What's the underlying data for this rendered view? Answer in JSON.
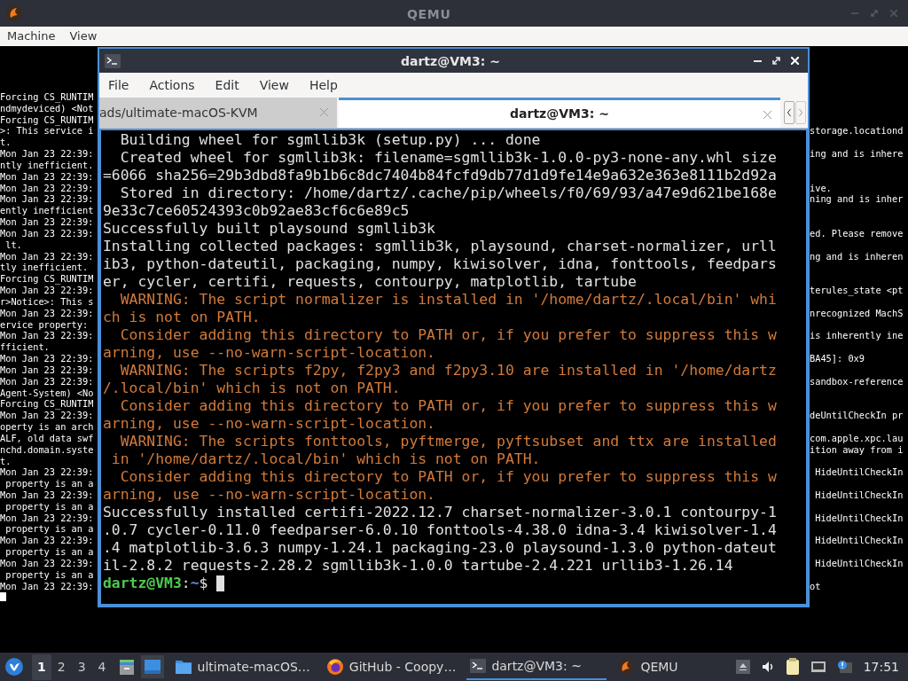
{
  "qemu_window": {
    "title": "QEMU",
    "menu": [
      "Machine",
      "View"
    ]
  },
  "console": {
    "lines": [
      {
        "left": "Forcing CS_RUNTIM"
      },
      {
        "left": "ndmydeviced) <Not"
      },
      {
        "left": "Forcing CS_RUNTIM"
      },
      {
        "left": ">: This service i",
        "right": "storage.locationd"
      },
      {
        "left": "t."
      },
      {
        "left": "Mon Jan 23 22:39:",
        "right": "ing and is inhere"
      },
      {
        "left": "ntly inefficient."
      },
      {
        "left": "Mon Jan 23 22:39:"
      },
      {
        "left": "Mon Jan 23 22:39:",
        "right": "ive."
      },
      {
        "left": "Mon Jan 23 22:39:",
        "right": "ning and is inher"
      },
      {
        "left": "ently inefficient"
      },
      {
        "left": "Mon Jan 23 22:39:"
      },
      {
        "left": "Mon Jan 23 22:39:",
        "right": "ed. Please remove"
      },
      {
        "left": " lt."
      },
      {
        "left": "Mon Jan 23 22:39:",
        "right": "ng and is inheren"
      },
      {
        "left": "tly inefficient."
      },
      {
        "left": "Forcing CS_RUNTIM"
      },
      {
        "left": "Mon Jan 23 22:39:",
        "right": "terules_state <pt"
      },
      {
        "left": "r>Notice>: This s"
      },
      {
        "left": "Mon Jan 23 22:39:",
        "right": "nrecognized MachS"
      },
      {
        "left": "ervice property:"
      },
      {
        "left": "Mon Jan 23 22:39:",
        "right": "is inherently ine"
      },
      {
        "left": "fficient."
      },
      {
        "left": "Mon Jan 23 22:39:",
        "right": "BA45]: 0x9"
      },
      {
        "left": "Mon Jan 23 22:39:"
      },
      {
        "left": "Mon Jan 23 22:39:",
        "right": "sandbox-reference"
      },
      {
        "left": "Agent-System) <No"
      },
      {
        "left": "Forcing CS_RUNTIM"
      },
      {
        "left": "Mon Jan 23 22:39:",
        "right": "deUntilCheckIn pr"
      },
      {
        "left": "operty is an arch"
      },
      {
        "left": "ALF, old data swf",
        "right": "com.apple.xpc.lau"
      },
      {
        "left": "nchd.domain.syste",
        "right": "ition away from i"
      },
      {
        "left": "t."
      },
      {
        "left": "Mon Jan 23 22:39:",
        "right": " HideUntilCheckIn"
      },
      {
        "left": " property is an a"
      },
      {
        "left": "Mon Jan 23 22:39:",
        "right": " HideUntilCheckIn"
      },
      {
        "left": " property is an a"
      },
      {
        "left": "Mon Jan 23 22:39:",
        "right": " HideUntilCheckIn"
      },
      {
        "left": " property is an a"
      },
      {
        "left": "Mon Jan 23 22:39:",
        "right": " HideUntilCheckIn"
      },
      {
        "left": " property is an a"
      },
      {
        "left": "Mon Jan 23 22:39:",
        "right": " HideUntilCheckIn"
      },
      {
        "left": " property is an a"
      },
      {
        "left": "Mon Jan 23 22:39:",
        "right": "ot"
      }
    ]
  },
  "terminal_window": {
    "title": "dartz@VM3: ~",
    "menu": [
      "File",
      "Actions",
      "Edit",
      "View",
      "Help"
    ],
    "tabs": [
      {
        "label": "ads/ultimate-macOS-KVM",
        "selected": false
      },
      {
        "label": "dartz@VM3: ~",
        "selected": true
      }
    ],
    "lines": [
      {
        "kind": "output",
        "text": "  Building wheel for sgmllib3k (setup.py) ... done"
      },
      {
        "kind": "output",
        "text": "  Created wheel for sgmllib3k: filename=sgmllib3k-1.0.0-py3-none-any.whl size"
      },
      {
        "kind": "output",
        "text": "=6066 sha256=29b3dbd8fa9b1b6c8dc7404b84fcfd9db77d1d9fe14e9a632e363e8111b2d92a"
      },
      {
        "kind": "output",
        "text": "  Stored in directory: /home/dartz/.cache/pip/wheels/f0/69/93/a47e9d621be168e"
      },
      {
        "kind": "output",
        "text": "9e33c7ce60524393c0b92ae83cf6c6e89c5"
      },
      {
        "kind": "output",
        "text": "Successfully built playsound sgmllib3k"
      },
      {
        "kind": "output",
        "text": "Installing collected packages: sgmllib3k, playsound, charset-normalizer, urll"
      },
      {
        "kind": "output",
        "text": "ib3, python-dateutil, packaging, numpy, kiwisolver, idna, fonttools, feedpars"
      },
      {
        "kind": "output",
        "text": "er, cycler, certifi, requests, contourpy, matplotlib, tartube"
      },
      {
        "kind": "warning",
        "text": "  WARNING: The script normalizer is installed in '/home/dartz/.local/bin' whi"
      },
      {
        "kind": "warning",
        "text": "ch is not on PATH."
      },
      {
        "kind": "warning",
        "text": "  Consider adding this directory to PATH or, if you prefer to suppress this w"
      },
      {
        "kind": "warning",
        "text": "arning, use --no-warn-script-location."
      },
      {
        "kind": "warning",
        "text": "  WARNING: The scripts f2py, f2py3 and f2py3.10 are installed in '/home/dartz"
      },
      {
        "kind": "warning",
        "text": "/.local/bin' which is not on PATH."
      },
      {
        "kind": "warning",
        "text": "  Consider adding this directory to PATH or, if you prefer to suppress this w"
      },
      {
        "kind": "warning",
        "text": "arning, use --no-warn-script-location."
      },
      {
        "kind": "warning",
        "text": "  WARNING: The scripts fonttools, pyftmerge, pyftsubset and ttx are installed"
      },
      {
        "kind": "warning",
        "text": " in '/home/dartz/.local/bin' which is not on PATH."
      },
      {
        "kind": "warning",
        "text": "  Consider adding this directory to PATH or, if you prefer to suppress this w"
      },
      {
        "kind": "warning",
        "text": "arning, use --no-warn-script-location."
      },
      {
        "kind": "output",
        "text": "Successfully installed certifi-2022.12.7 charset-normalizer-3.0.1 contourpy-1"
      },
      {
        "kind": "output",
        "text": ".0.7 cycler-0.11.0 feedparser-6.0.10 fonttools-4.38.0 idna-3.4 kiwisolver-1.4"
      },
      {
        "kind": "output",
        "text": ".4 matplotlib-3.6.3 numpy-1.24.1 packaging-23.0 playsound-1.3.0 python-dateut"
      },
      {
        "kind": "output",
        "text": "il-2.8.2 requests-2.28.2 sgmllib3k-1.0.0 tartube-2.4.221 urllib3-1.26.14"
      }
    ],
    "prompt": {
      "user_host": "dartz@VM3",
      "separator": ":",
      "path": "~",
      "symbol": "$"
    }
  },
  "taskbar": {
    "workspaces": [
      {
        "label": "1",
        "selected": true
      },
      {
        "label": "2",
        "selected": false
      },
      {
        "label": "3",
        "selected": false
      },
      {
        "label": "4",
        "selected": false
      }
    ],
    "tasks": [
      {
        "kind": "folder",
        "label": "ultimate-macOS…",
        "selected": false
      },
      {
        "kind": "browser",
        "label": "GitHub - Coopy…",
        "selected": false
      },
      {
        "kind": "terminal",
        "label": "dartz@VM3: ~",
        "selected": true
      },
      {
        "kind": "qemu",
        "label": "QEMU",
        "selected": false
      }
    ],
    "clock": "17:51"
  }
}
